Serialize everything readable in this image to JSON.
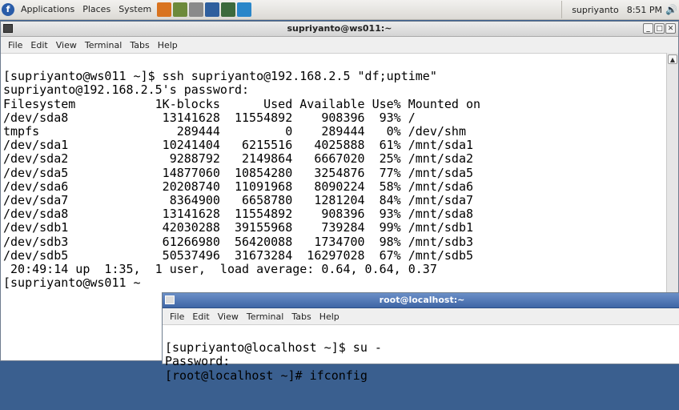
{
  "panel": {
    "menus": [
      "Applications",
      "Places",
      "System"
    ],
    "user": "supriyanto",
    "clock": "8:51 PM",
    "launcher_colors": [
      "#d9731f",
      "#6d8a3a",
      "#8a8a8a",
      "#2f5f9e",
      "#3c6a3c",
      "#2a86c9"
    ]
  },
  "window1": {
    "title": "supriyanto@ws011:~",
    "menu": [
      "File",
      "Edit",
      "View",
      "Terminal",
      "Tabs",
      "Help"
    ],
    "lines": [
      "[supriyanto@ws011 ~]$ ssh supriyanto@192.168.2.5 \"df;uptime\"",
      "supriyanto@192.168.2.5's password:",
      "Filesystem           1K-blocks      Used Available Use% Mounted on",
      "/dev/sda8             13141628  11554892    908396  93% /",
      "tmpfs                   289444         0    289444   0% /dev/shm",
      "/dev/sda1             10241404   6215516   4025888  61% /mnt/sda1",
      "/dev/sda2              9288792   2149864   6667020  25% /mnt/sda2",
      "/dev/sda5             14877060  10854280   3254876  77% /mnt/sda5",
      "/dev/sda6             20208740  11091968   8090224  58% /mnt/sda6",
      "/dev/sda7              8364900   6658780   1281204  84% /mnt/sda7",
      "/dev/sda8             13141628  11554892    908396  93% /mnt/sda8",
      "/dev/sdb1             42030288  39155968    739284  99% /mnt/sdb1",
      "/dev/sdb3             61266980  56420088   1734700  98% /mnt/sdb3",
      "/dev/sdb5             50537496  31673284  16297028  67% /mnt/sdb5",
      " 20:49:14 up  1:35,  1 user,  load average: 0.64, 0.64, 0.37",
      "[supriyanto@ws011 ~"
    ]
  },
  "window2": {
    "title": "root@localhost:~",
    "menu": [
      "File",
      "Edit",
      "View",
      "Terminal",
      "Tabs",
      "Help"
    ],
    "lines": [
      "[supriyanto@localhost ~]$ su -",
      "Password:",
      "[root@localhost ~]# ifconfig"
    ]
  }
}
